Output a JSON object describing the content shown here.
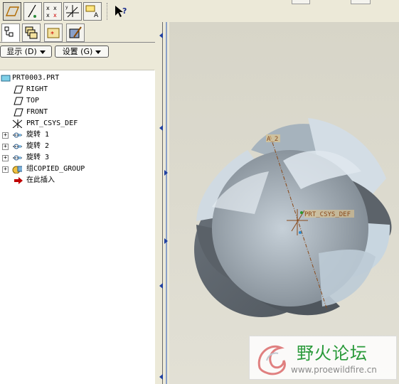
{
  "toolbar": {
    "buttons": [
      {
        "icon": "datum-plane-display-icon",
        "active": true
      },
      {
        "icon": "datum-axis-display-icon",
        "active": false
      },
      {
        "icon": "datum-point-display-icon",
        "active": false
      },
      {
        "icon": "coordinate-system-display-icon",
        "active": false
      },
      {
        "icon": "annotation-display-icon",
        "active": false
      }
    ],
    "help_icon": "context-help-icon"
  },
  "panel": {
    "tabs": [
      "model-tree-tab",
      "layers-tab",
      "favorites-tab",
      "tools-tab"
    ],
    "show_button": "显示 (D)",
    "settings_button": "设置 (G)"
  },
  "tree": {
    "items": [
      {
        "label": "PRT0003.PRT",
        "icon": "part-icon",
        "expand": false,
        "indent": 0
      },
      {
        "label": "RIGHT",
        "icon": "datum-plane-icon",
        "expand": false,
        "indent": 1
      },
      {
        "label": "TOP",
        "icon": "datum-plane-icon",
        "expand": false,
        "indent": 1
      },
      {
        "label": "FRONT",
        "icon": "datum-plane-icon",
        "expand": false,
        "indent": 1
      },
      {
        "label": "PRT_CSYS_DEF",
        "icon": "csys-icon",
        "expand": false,
        "indent": 1
      },
      {
        "label": "旋转 1",
        "icon": "revolve-icon",
        "expand": true,
        "indent": 1
      },
      {
        "label": "旋转 2",
        "icon": "revolve-icon",
        "expand": true,
        "indent": 1
      },
      {
        "label": "旋转 3",
        "icon": "revolve-icon",
        "expand": true,
        "indent": 1
      },
      {
        "label": "组COPIED_GROUP",
        "icon": "group-icon",
        "expand": true,
        "indent": 1
      },
      {
        "label": "在此插入",
        "icon": "insert-here-arrow-icon",
        "expand": false,
        "indent": 1
      }
    ]
  },
  "viewport": {
    "axis_label": "A_2",
    "csys_label": "PRT_CSYS_DEF",
    "colors": {
      "light": "#c9d4dc",
      "dark": "#6b737b",
      "bg": "#dcdace"
    }
  },
  "watermark": {
    "title": "野火论坛",
    "url": "www.proewildfire.cn"
  }
}
